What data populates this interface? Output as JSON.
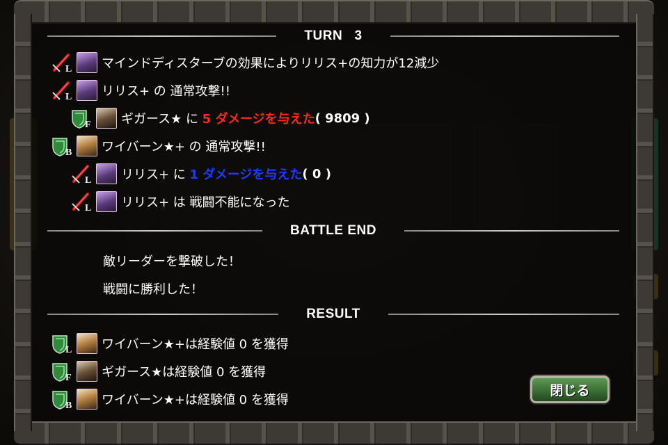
{
  "headers": {
    "turn": "TURN   3",
    "battle_end": "BATTLE END",
    "result": "RESULT"
  },
  "log": [
    {
      "badge": "sword-L",
      "portrait": "lilith",
      "indent": 0,
      "text": "マインドディスターブの効果によりリリス+の知力が12減少"
    },
    {
      "badge": "sword-L",
      "portrait": "lilith",
      "indent": 0,
      "text": "リリス+ の 通常攻撃!!"
    },
    {
      "badge": "shield-F",
      "portrait": "gigas",
      "indent": 1,
      "pre": "ギガース★ に ",
      "damage": "5 ダメージを与えた",
      "post": "( 9809 )",
      "color": "red"
    },
    {
      "badge": "shield-B",
      "portrait": "wyvern",
      "indent": 0,
      "text": "ワイバーン★+ の 通常攻撃!!"
    },
    {
      "badge": "sword-L",
      "portrait": "lilith",
      "indent": 1,
      "pre": "リリス+ に ",
      "damage": "1 ダメージを与えた",
      "post": "( 0 )",
      "color": "blue"
    },
    {
      "badge": "sword-L",
      "portrait": "lilith",
      "indent": 1,
      "text": "リリス+ は 戦闘不能になった"
    }
  ],
  "battle_end_messages": [
    "敵リーダーを撃破した！",
    "戦闘に勝利した！"
  ],
  "results": [
    {
      "badge": "shield-L",
      "portrait": "wyvern",
      "text": "ワイバーン★+は経験値 0 を獲得"
    },
    {
      "badge": "shield-F",
      "portrait": "gigas",
      "text": "ギガース★は経験値 0 を獲得"
    },
    {
      "badge": "shield-B",
      "portrait": "wyvern",
      "text": "ワイバーン★+は経験値 0 を獲得"
    }
  ],
  "buttons": {
    "close": "閉じる"
  },
  "colors": {
    "damage_red": "#ff2a1a",
    "damage_blue": "#1e3cff",
    "button_green": "#3b6f36"
  }
}
